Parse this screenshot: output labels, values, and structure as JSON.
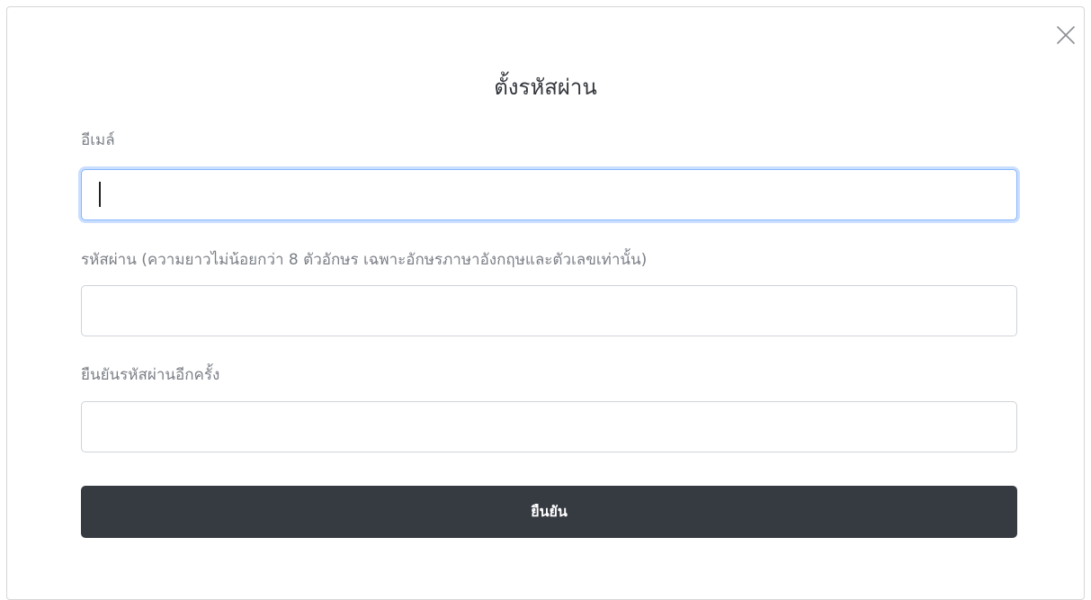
{
  "dialog": {
    "title": "ตั้งรหัสผ่าน",
    "close_icon": "close-icon"
  },
  "form": {
    "email": {
      "label": "อีเมล์",
      "value": "",
      "placeholder": ""
    },
    "password": {
      "label": "รหัสผ่าน (ความยาวไม่น้อยกว่า 8 ตัวอักษร เฉพาะอักษรภาษาอังกฤษและตัวเลขเท่านั้น)",
      "value": "",
      "placeholder": ""
    },
    "confirm_password": {
      "label": "ยืนยันรหัสผ่านอีกครั้ง",
      "value": "",
      "placeholder": ""
    },
    "submit_label": "ยืนยัน"
  },
  "colors": {
    "button_bg": "#363a41",
    "focus_border": "#86b7fe",
    "label_text": "#7b7f86"
  }
}
